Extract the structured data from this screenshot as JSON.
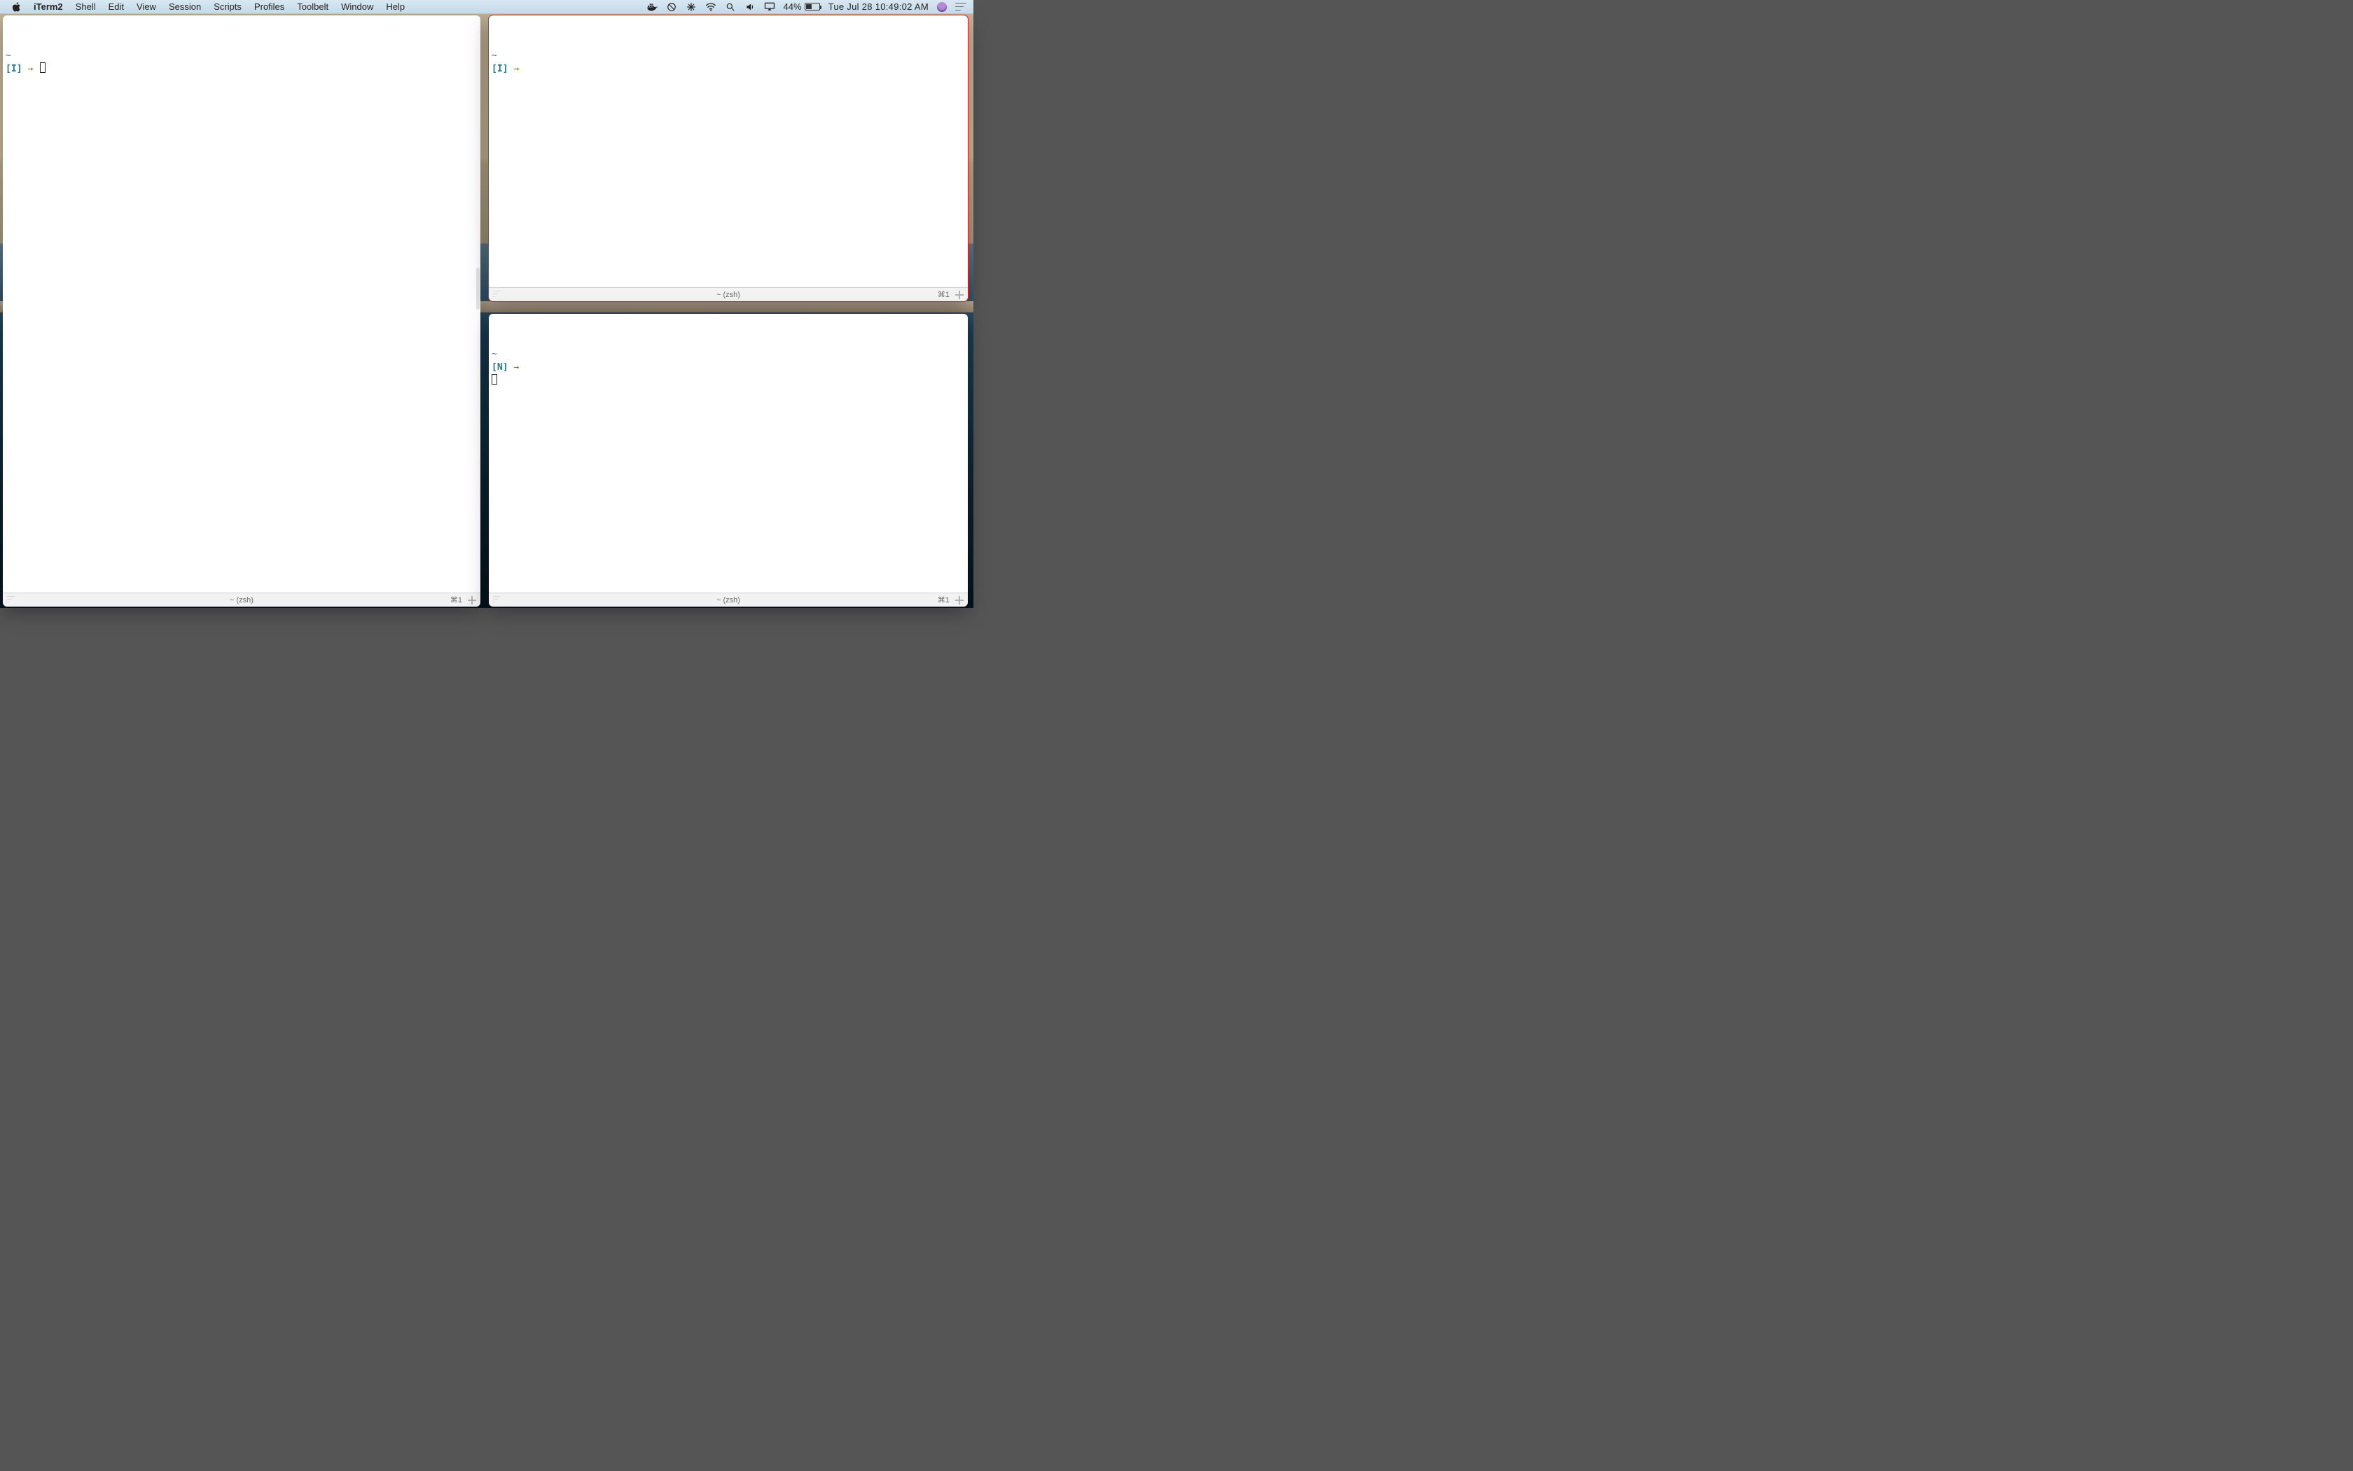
{
  "menubar": {
    "app_name": "iTerm2",
    "items": [
      "Shell",
      "Edit",
      "View",
      "Session",
      "Scripts",
      "Profiles",
      "Toolbelt",
      "Window",
      "Help"
    ],
    "battery_percent": "44%",
    "clock": "Tue Jul 28  10:49:02 AM"
  },
  "panes": {
    "left": {
      "path_line": "~",
      "mode": "[I]",
      "arrow": "→",
      "status_title": "~ (zsh)",
      "tab_shortcut": "⌘1"
    },
    "right_top": {
      "path_line": "~",
      "mode": "[I]",
      "arrow": "→",
      "status_title": "~ (zsh)",
      "tab_shortcut": "⌘1"
    },
    "right_bottom": {
      "path_line": "~",
      "mode": "[N]",
      "arrow": "→",
      "status_title": "~ (zsh)",
      "tab_shortcut": "⌘1"
    }
  }
}
